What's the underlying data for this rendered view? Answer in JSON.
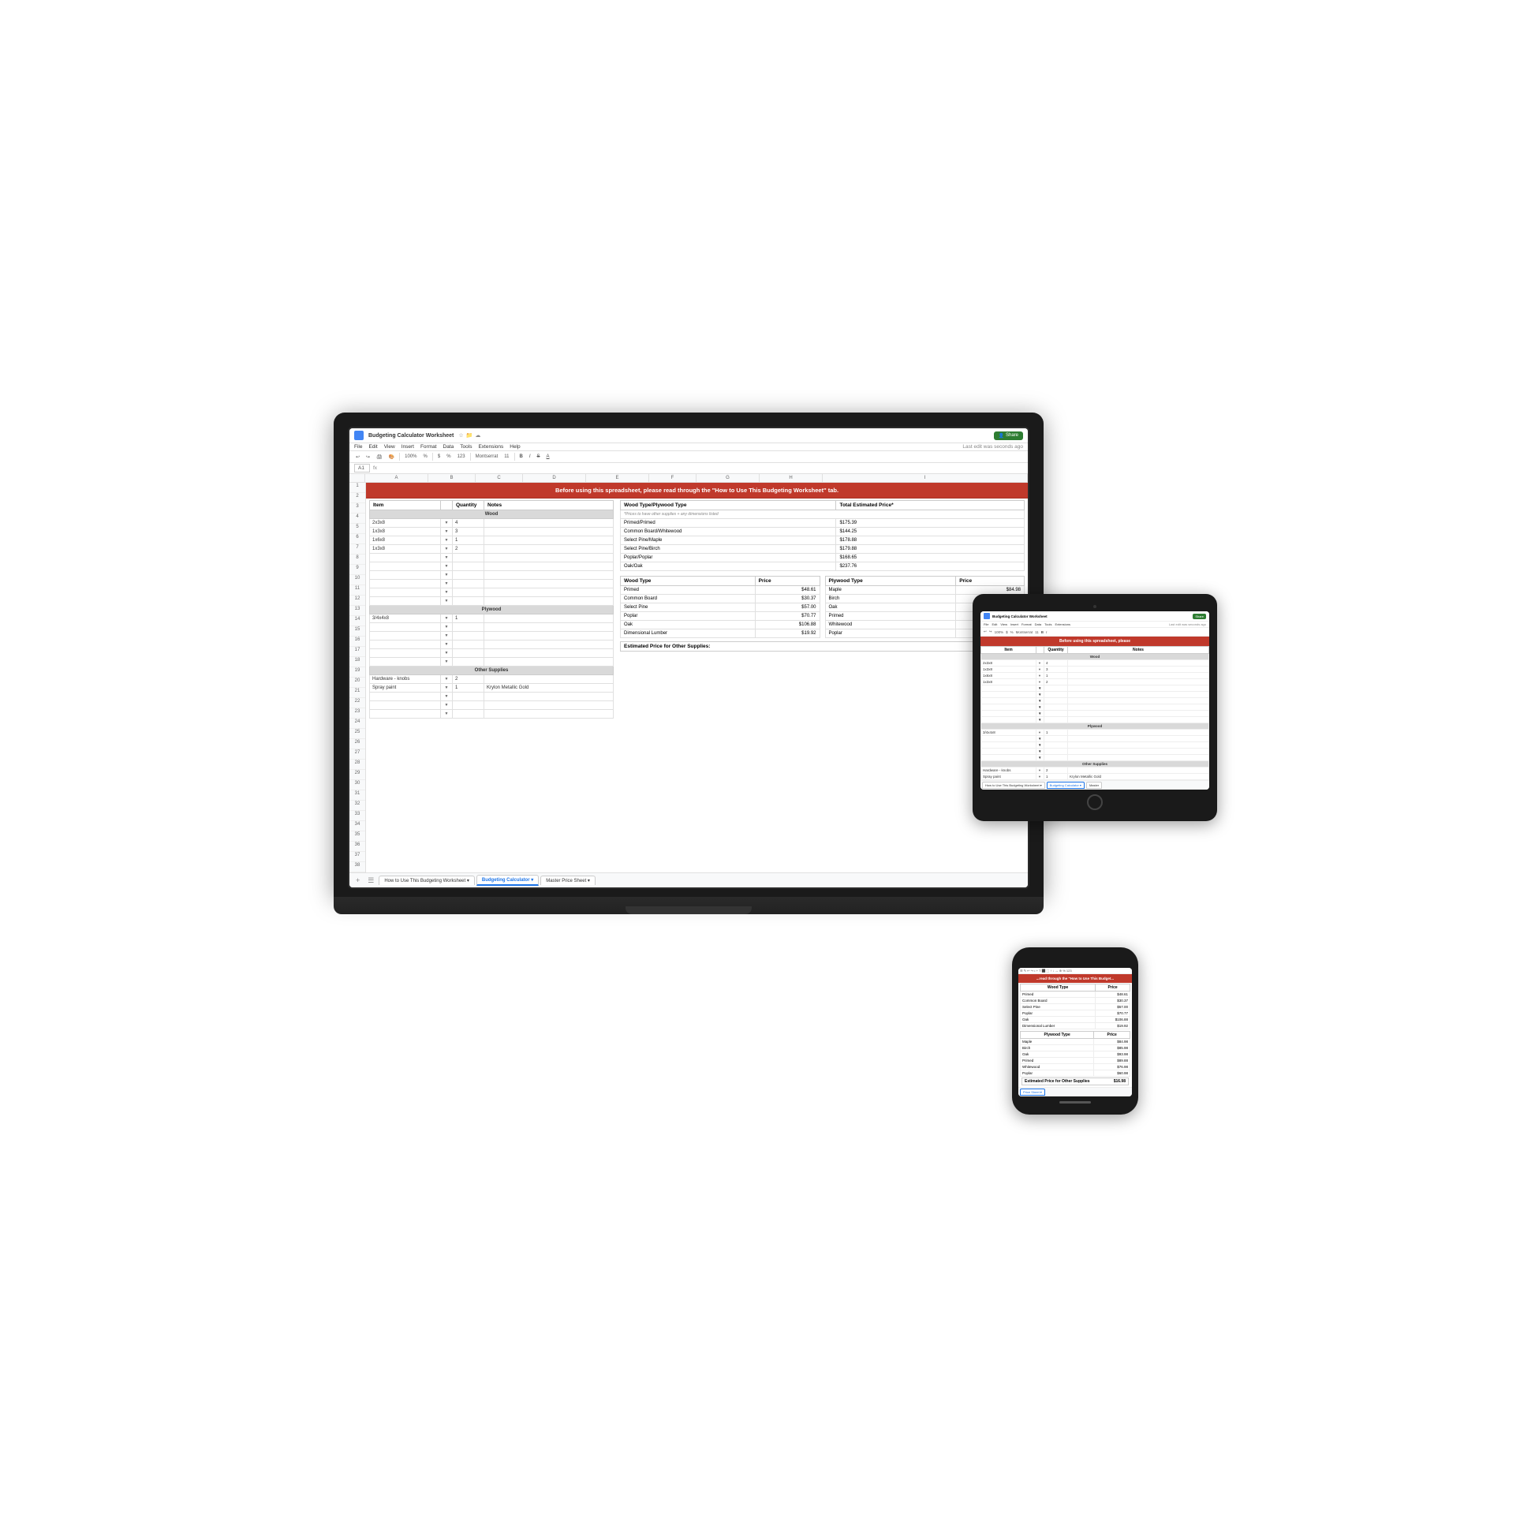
{
  "laptop": {
    "title": "Budgeting Calculator Worksheet",
    "last_edit": "Last edit was seconds ago",
    "menu": [
      "File",
      "Edit",
      "View",
      "Insert",
      "Format",
      "Data",
      "Tools",
      "Extensions",
      "Help"
    ],
    "zoom": "100%",
    "font": "Montserrat",
    "font_size": "11",
    "share_button": "Share",
    "banner_text": "Before using this spreadsheet, please read through the \"How to Use This Budgeting Worksheet\" tab.",
    "formula_bar": "fx",
    "col_headers": [
      "A",
      "B",
      "C",
      "D",
      "E",
      "F",
      "G",
      "H",
      "I"
    ],
    "tabs": [
      "How to Use This Budgeting Worksheet",
      "Budgeting Calculator",
      "Master Price Sheet"
    ]
  },
  "spreadsheet": {
    "item_table": {
      "headers": [
        "Item",
        "Quantity",
        "Notes"
      ],
      "sections": [
        {
          "name": "Wood",
          "rows": [
            {
              "item": "2x3x8",
              "qty": "4",
              "note": ""
            },
            {
              "item": "1x3x8",
              "qty": "3",
              "note": ""
            },
            {
              "item": "1x6x8",
              "qty": "1",
              "note": ""
            },
            {
              "item": "1x3x8",
              "qty": "2",
              "note": ""
            },
            {
              "item": "",
              "qty": "",
              "note": ""
            },
            {
              "item": "",
              "qty": "",
              "note": ""
            },
            {
              "item": "",
              "qty": "",
              "note": ""
            },
            {
              "item": "",
              "qty": "",
              "note": ""
            },
            {
              "item": "",
              "qty": "",
              "note": ""
            },
            {
              "item": "",
              "qty": "",
              "note": ""
            }
          ]
        },
        {
          "name": "Plywood",
          "rows": [
            {
              "item": "3/4x4x8",
              "qty": "1",
              "note": ""
            },
            {
              "item": "",
              "qty": "",
              "note": ""
            },
            {
              "item": "",
              "qty": "",
              "note": ""
            },
            {
              "item": "",
              "qty": "",
              "note": ""
            },
            {
              "item": "",
              "qty": "",
              "note": ""
            },
            {
              "item": "",
              "qty": "",
              "note": ""
            }
          ]
        },
        {
          "name": "Other Supplies",
          "rows": [
            {
              "item": "Hardware - knobs",
              "qty": "2",
              "note": ""
            },
            {
              "item": "Spray paint",
              "qty": "1",
              "note": "Krylon Metallic Gold"
            },
            {
              "item": "",
              "qty": "",
              "note": ""
            },
            {
              "item": "",
              "qty": "",
              "note": ""
            },
            {
              "item": "",
              "qty": "",
              "note": ""
            }
          ]
        }
      ]
    },
    "wood_type_table": {
      "title": "Wood Type/Plywood Type",
      "price_col": "Total Estimated Price*",
      "note": "*Prices to have other supplies + any dimensions listed",
      "rows": [
        {
          "type": "Primed/Primed",
          "price": "$175.39"
        },
        {
          "type": "Common Board/Whitewood",
          "price": "$144.25"
        },
        {
          "type": "Select Pine/Maple",
          "price": "$178.88"
        },
        {
          "type": "Select Pine/Birch",
          "price": "$179.88"
        },
        {
          "type": "Poplar/Poplar",
          "price": "$168.65"
        },
        {
          "type": "Oak/Oak",
          "price": "$237.76"
        }
      ]
    },
    "wood_type_price_table": {
      "title": "Wood Type Price",
      "col1": "Wood Type",
      "col2": "Price",
      "rows": [
        {
          "type": "Primed",
          "price": "$48.61"
        },
        {
          "type": "Common Board",
          "price": "$30.37"
        },
        {
          "type": "Select Pine",
          "price": "$57.00"
        },
        {
          "type": "Poplar",
          "price": "$70.77"
        },
        {
          "type": "Oak",
          "price": "$106.88"
        },
        {
          "type": "Dimensional Lumber",
          "price": "$19.92"
        }
      ]
    },
    "plywood_type_price_table": {
      "col1": "Plywood Type",
      "col2": "Price",
      "rows": [
        {
          "type": "Maple",
          "price": "$84.98"
        },
        {
          "type": "Birch",
          "price": "$85.98"
        },
        {
          "type": "Oak",
          "price": "$93.98"
        },
        {
          "type": "Primed",
          "price": "$89.88"
        },
        {
          "type": "Whitewood",
          "price": "$76.98"
        },
        {
          "type": "Poplar",
          "price": "$60.98"
        }
      ]
    },
    "other_supplies_footer": {
      "label": "Estimated Price for Other Supplies:",
      "value": "$16.98"
    }
  },
  "tablet": {
    "title": "Budgeting Calculator Worksheet",
    "last_edit": "Last edit was seconds ago",
    "banner_text": "Before using this spreadsheet, please",
    "tabs": [
      "How to Use This Budgeting Worksheet",
      "Budgeting Calculator",
      "Master"
    ]
  },
  "phone": {
    "title": "Budgeting Calculator Worksheet",
    "banner_text": "...read through the \"How to Use This Budget...",
    "tabs": [
      "Price Sheet"
    ]
  },
  "colors": {
    "banner_bg": "#c0392b",
    "banner_text": "#ffffff",
    "section_header_bg": "#d9d9d9",
    "border": "#cccccc",
    "row_even": "#f8f9fa",
    "active_tab_indicator": "#1a73e8"
  }
}
